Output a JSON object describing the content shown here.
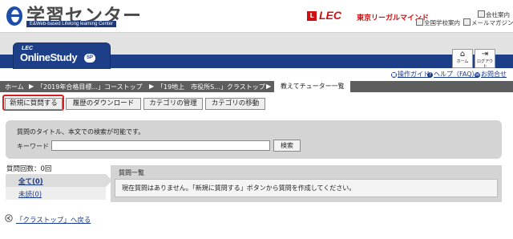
{
  "header": {
    "logo_title": "学習センター",
    "logo_subtitle": "E&Web-based Lifelong learning Center",
    "lec_mark": "L",
    "lec_word": "LEC",
    "lec_tagline": "東京リーガルマインド",
    "company_link": "会社案内",
    "schools_link": "全国学校案内",
    "mailmag_link": "メールマガジン"
  },
  "banner": {
    "brand_prefix": "LEC",
    "brand_name": "OnlineStudy",
    "brand_badge": "SP",
    "home_label": "ホーム",
    "logout_label": "ログアウト"
  },
  "help_links": {
    "guide": "操作ガイド",
    "faq": "ヘルプ（FAQ）",
    "contact": "お問合せ"
  },
  "breadcrumb": {
    "items": [
      "ホーム",
      "「2019年合格目標...」コーストップ",
      "「19地上　市役所S...」クラストップ"
    ],
    "current": "教えてチューター一覧"
  },
  "toolbar": {
    "new_question": "新規に質問する",
    "history_download": "履歴のダウンロード",
    "category_manage": "カテゴリの管理",
    "category_move": "カテゴリの移動"
  },
  "search": {
    "note": "質問のタイトル、本文での検索が可能です。",
    "keyword_label": "キーワード",
    "keyword_value": "",
    "button_label": "検索"
  },
  "filter": {
    "count_label": "質問回数：0回",
    "all": "全て(0)",
    "unresolved": "未読(0)"
  },
  "question_list": {
    "title": "質問一覧",
    "empty_message": "現在質問はありません。「新規に質問する」ボタンから質問を作成してください。"
  },
  "back": {
    "label": "「クラストップ」へ戻る"
  },
  "colors": {
    "navy": "#1c3f87",
    "lec_red": "#d01010",
    "highlight_red": "#d42020",
    "breadcrumb_gray": "#5e5e5e",
    "panel_gray": "#d4d4d4"
  }
}
